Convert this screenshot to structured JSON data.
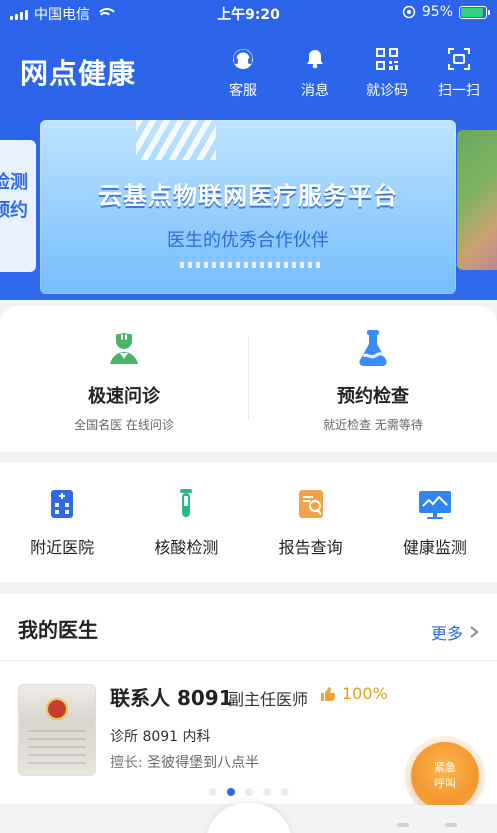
{
  "statusbar": {
    "carrier": "中国电信",
    "time": "上午9:20",
    "battery": "95%"
  },
  "header": {
    "app_title": "网点健康"
  },
  "top_actions": [
    {
      "label": "客服",
      "icon": "headset-icon"
    },
    {
      "label": "消息",
      "icon": "bell-icon"
    },
    {
      "label": "就诊码",
      "icon": "qr-code-icon"
    },
    {
      "label": "扫一扫",
      "icon": "scan-icon"
    }
  ],
  "banner": {
    "title": "云基点物联网医疗服务平台",
    "subtitle": "医生的优秀合作伙伴",
    "left_card_text1": "检测",
    "left_card_text2": "预约"
  },
  "services_big": [
    {
      "title": "极速问诊",
      "subtitle": "全国名医 在线问诊",
      "icon": "doctor-icon"
    },
    {
      "title": "预约检查",
      "subtitle": "就近检查 无需等待",
      "icon": "flask-icon"
    }
  ],
  "services_small": [
    {
      "label": "附近医院",
      "icon": "hospital-icon"
    },
    {
      "label": "核酸检测",
      "icon": "test-tube-icon"
    },
    {
      "label": "报告查询",
      "icon": "report-search-icon"
    },
    {
      "label": "健康监测",
      "icon": "monitor-icon"
    }
  ],
  "my_doctor": {
    "title": "我的医生",
    "more": "更多",
    "doctor": {
      "name": "联系人 8091",
      "title": "副主任医师",
      "rating": "100%",
      "dept": "诊所 8091 内科",
      "skill_prefix": "擅长:",
      "skill": "圣彼得堡到八点半"
    },
    "pages": 5,
    "active_page": 1
  },
  "emergency": {
    "line1": "紧急",
    "line2": "呼叫"
  }
}
